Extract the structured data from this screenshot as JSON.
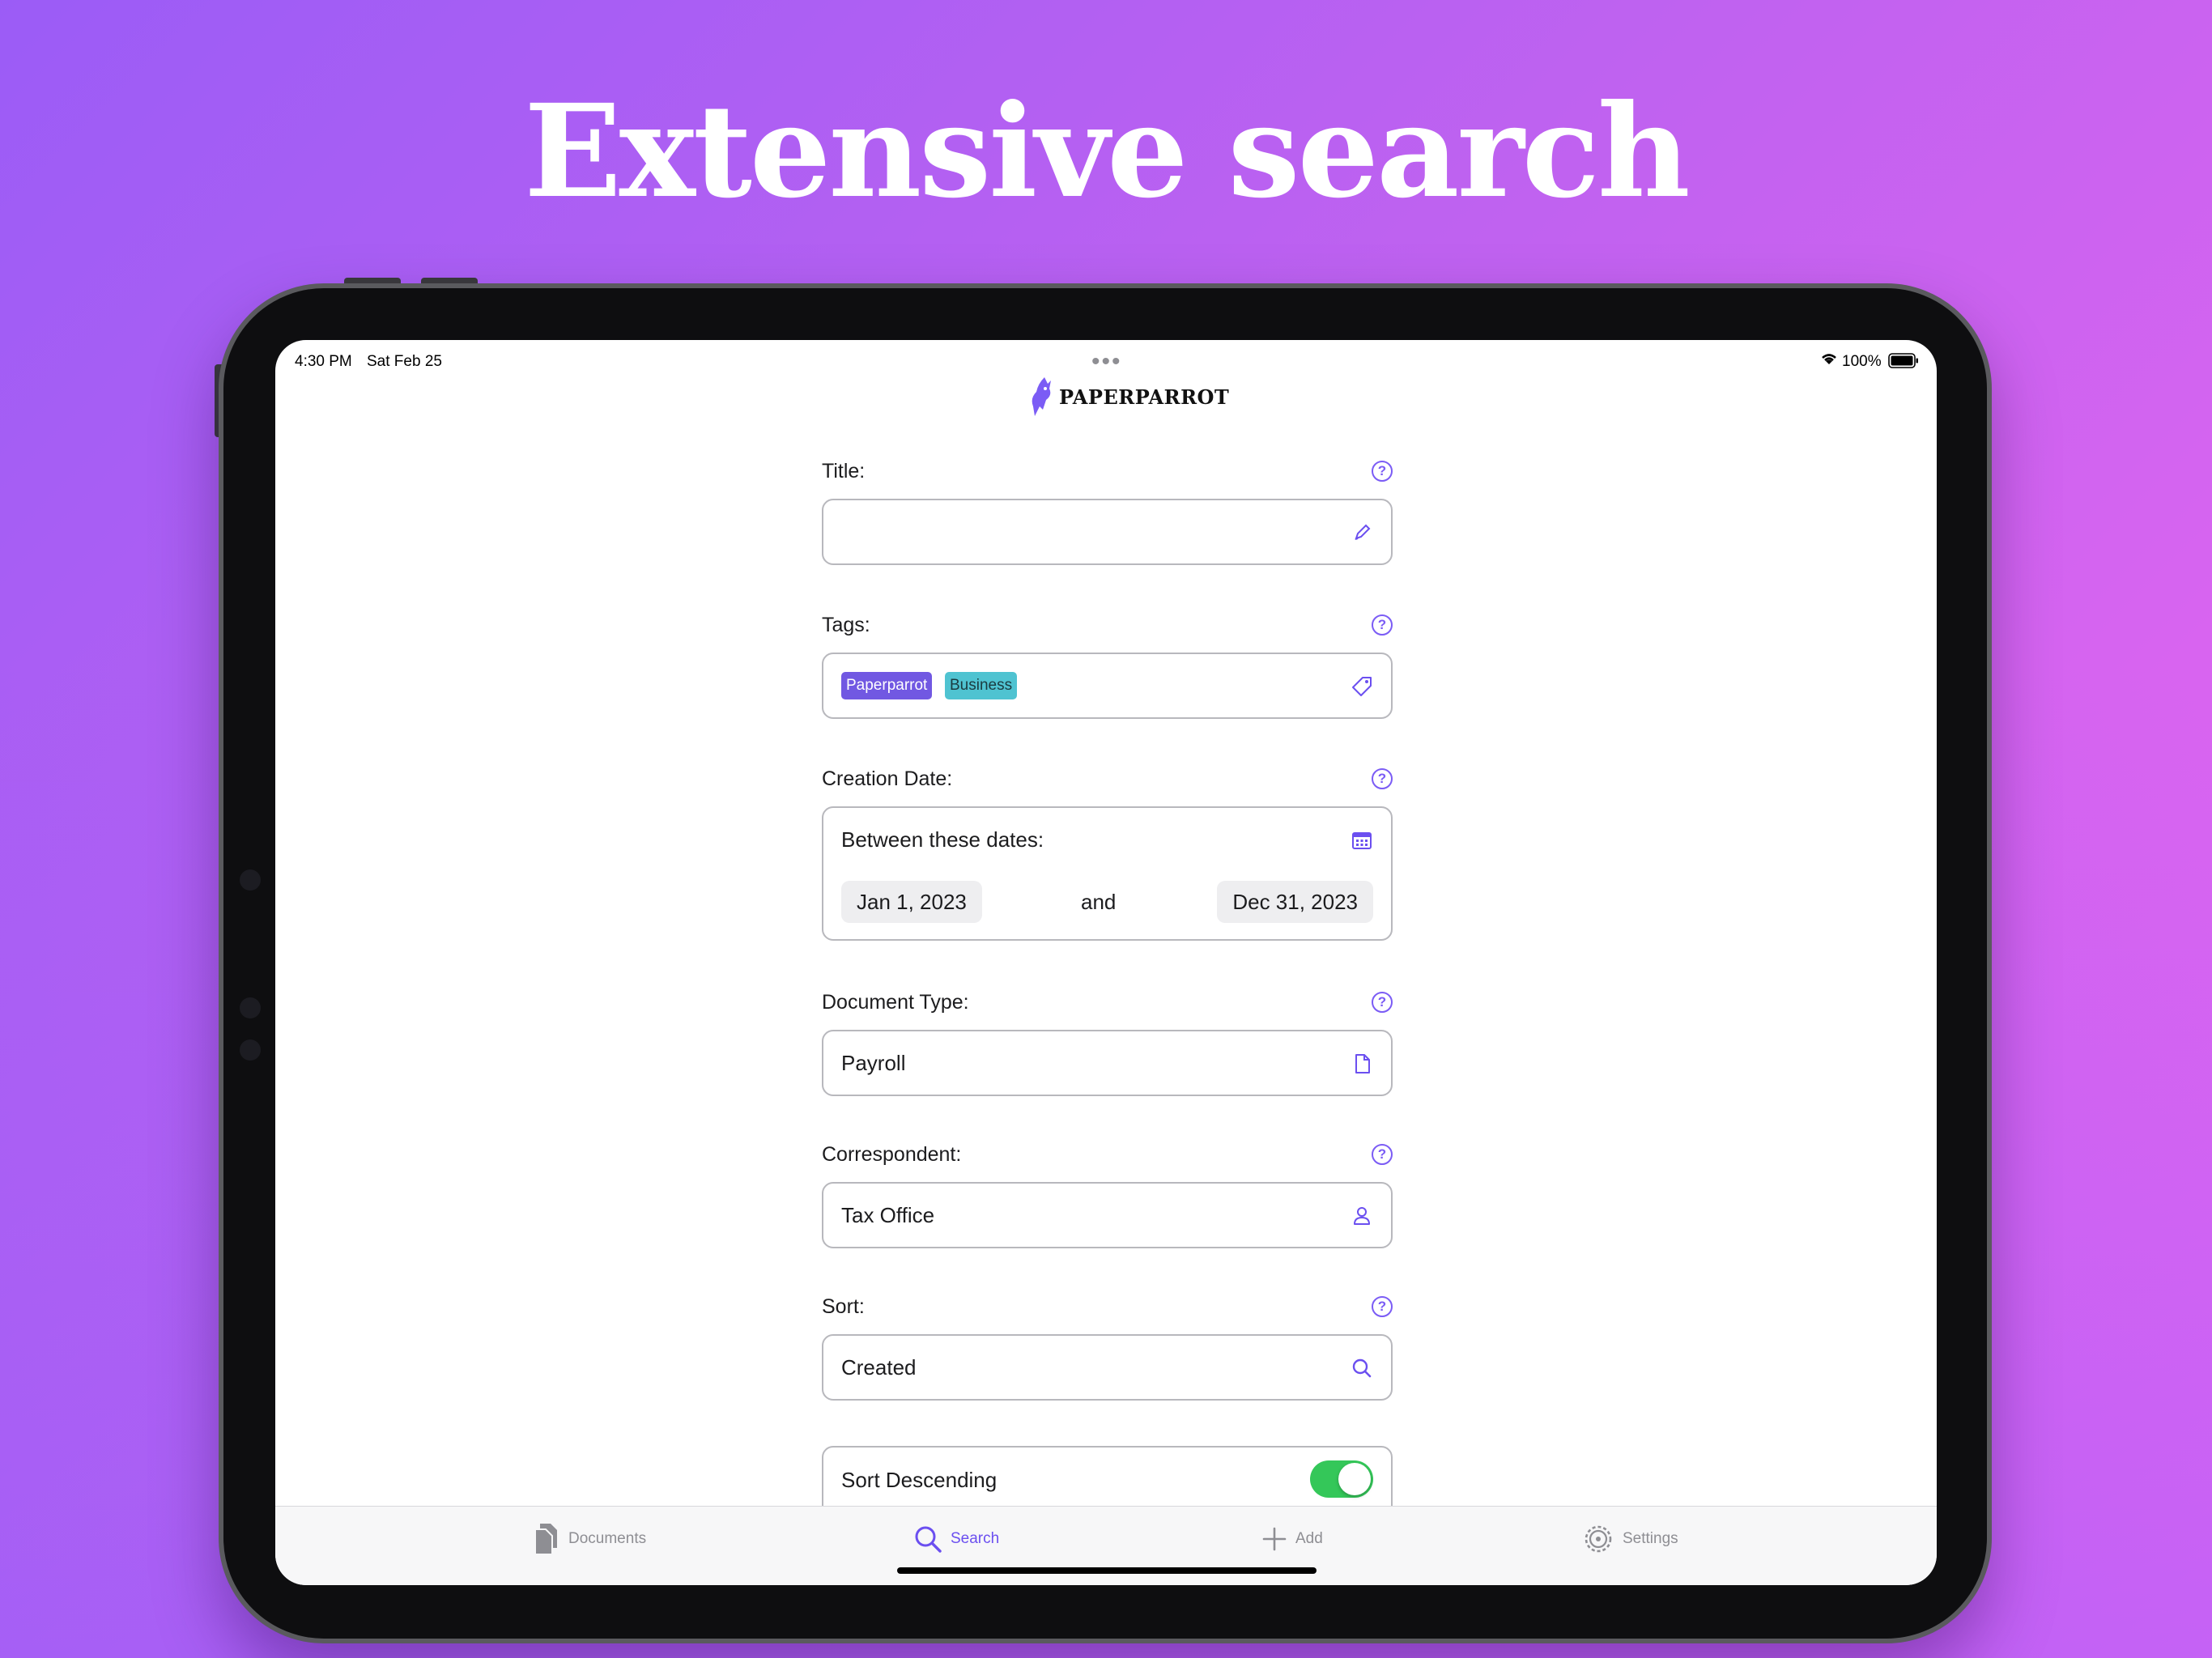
{
  "headline": "Extensive search",
  "status_bar": {
    "time": "4:30 PM",
    "date": "Sat Feb 25",
    "battery": "100%"
  },
  "app": {
    "logo_text": "PAPERPARROT"
  },
  "form": {
    "title": {
      "label": "Title:",
      "value": ""
    },
    "tags": {
      "label": "Tags:",
      "items": [
        "Paperparrot",
        "Business"
      ]
    },
    "creation_date": {
      "label": "Creation Date:",
      "mode": "Between these dates:",
      "start": "Jan 1, 2023",
      "connector": "and",
      "end": "Dec 31, 2023"
    },
    "document_type": {
      "label": "Document Type:",
      "value": "Payroll"
    },
    "correspondent": {
      "label": "Correspondent:",
      "value": "Tax Office"
    },
    "sort": {
      "label": "Sort:",
      "value": "Created"
    },
    "sort_descending": {
      "label": "Sort Descending",
      "enabled": true
    }
  },
  "tabbar": {
    "items": [
      {
        "label": "Documents",
        "icon": "documents-icon",
        "active": false
      },
      {
        "label": "Search",
        "icon": "search-icon",
        "active": true
      },
      {
        "label": "Add",
        "icon": "plus-icon",
        "active": false
      },
      {
        "label": "Settings",
        "icon": "gear-icon",
        "active": false
      }
    ]
  },
  "colors": {
    "accent": "#6b4ff0",
    "tag_primary": "#7158e2",
    "tag_secondary": "#4fc3d1",
    "toggle_on": "#34c759"
  }
}
